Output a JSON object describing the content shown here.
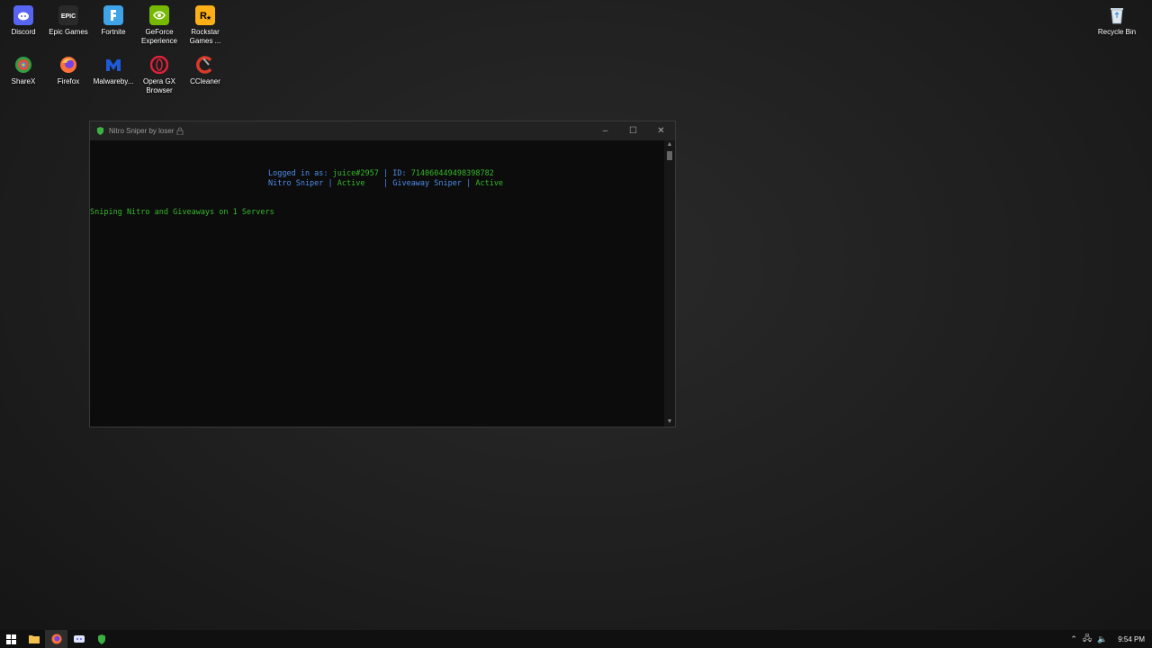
{
  "desktop": {
    "icons": [
      {
        "label": "Discord",
        "icon": "discord-icon",
        "color": "#5865f2"
      },
      {
        "label": "Epic Games",
        "icon": "epic-games-icon",
        "color": "#2a2a2a"
      },
      {
        "label": "Fortnite",
        "icon": "fortnite-icon",
        "color": "#3fa3e8"
      },
      {
        "label": "GeForce\nExperience",
        "icon": "geforce-experience-icon",
        "color": "#76b900"
      },
      {
        "label": "Rockstar\nGames ...",
        "icon": "rockstar-games-icon",
        "color": "#fcaf17"
      },
      {
        "label": "ShareX",
        "icon": "sharex-icon",
        "color": "#2ea043"
      },
      {
        "label": "Firefox",
        "icon": "firefox-icon",
        "color": "#ff7139"
      },
      {
        "label": "Malwareby...",
        "icon": "malwarebytes-icon",
        "color": "#1e5bd8"
      },
      {
        "label": "Opera GX\nBrowser",
        "icon": "opera-gx-icon",
        "color": "#e0213b"
      },
      {
        "label": "CCleaner",
        "icon": "ccleaner-icon",
        "color": "#d93a2a"
      }
    ],
    "recycle_bin": {
      "label": "Recycle Bin",
      "icon": "recycle-bin-icon"
    }
  },
  "window": {
    "title": "Nitro Sniper by loser",
    "controls": {
      "minimize": "–",
      "maximize": "☐",
      "close": "✕"
    },
    "console": {
      "logged_prefix": "Logged in as: ",
      "username": "juice#2957",
      "id_sep": " | ",
      "id_prefix": "ID: ",
      "id_value": "714060449498398782",
      "nitro_label": "Nitro Sniper",
      "nitro_sep": " | ",
      "nitro_status": "Active",
      "giveaway_sep": "    | ",
      "giveaway_label": "Giveaway Sniper",
      "giveaway_sep2": " | ",
      "giveaway_status": "Active",
      "status_line": "Sniping Nitro and Giveaways on 1 Servers"
    }
  },
  "taskbar": {
    "clock": "9:54 PM",
    "tray": {
      "chevron": "⌃",
      "network": "🖧",
      "volume": "🔈"
    }
  },
  "colors": {
    "console_blue": "#4f8be8",
    "console_green": "#35b82b"
  }
}
